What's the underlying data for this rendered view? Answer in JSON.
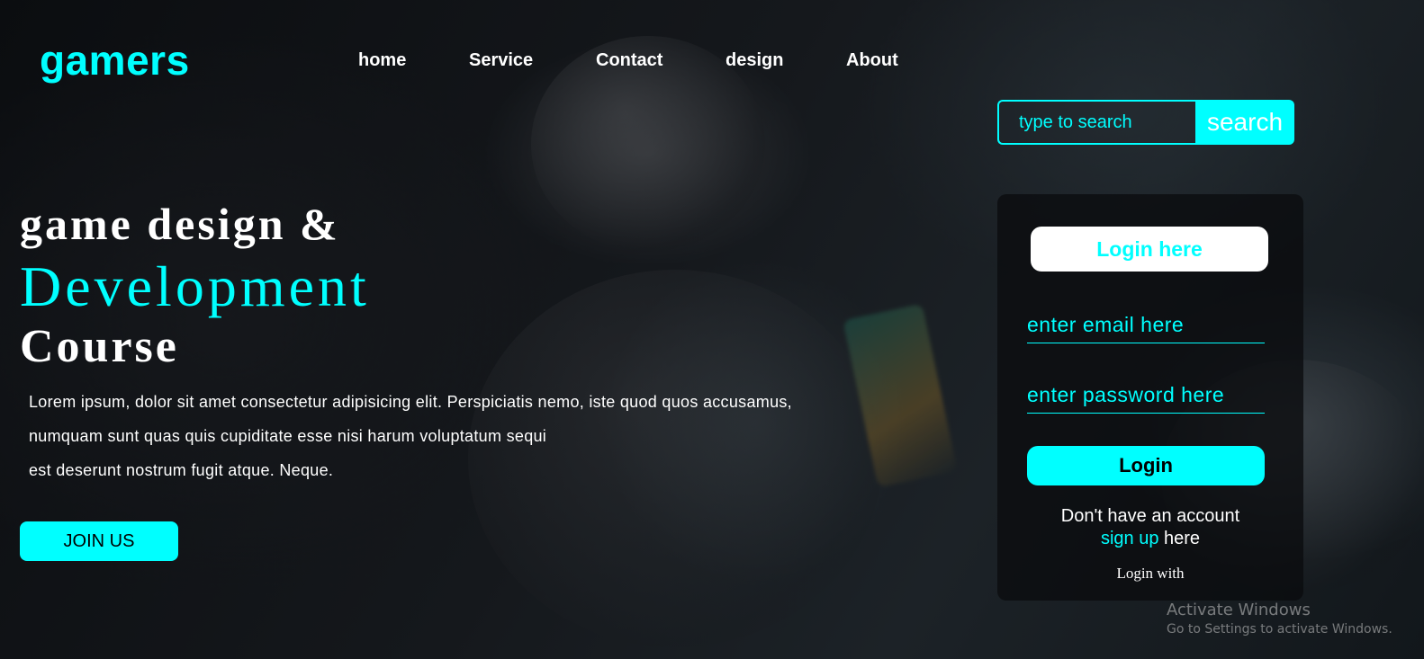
{
  "brand": {
    "logo": "gamers",
    "accent_color": "#00ffff"
  },
  "nav": {
    "items": [
      {
        "label": "home"
      },
      {
        "label": "Service"
      },
      {
        "label": "Contact"
      },
      {
        "label": "design"
      },
      {
        "label": "About"
      }
    ]
  },
  "search": {
    "placeholder": "type to search",
    "button_label": "search"
  },
  "hero": {
    "line1": "game design &",
    "line2": "Development",
    "line3": "Course",
    "paragraph": [
      "Lorem ipsum, dolor sit amet consectetur adipisicing elit. Perspiciatis nemo, iste quod quos accusamus,",
      "numquam sunt quas quis cupiditate esse nisi harum voluptatum sequi",
      "est deserunt nostrum fugit atque. Neque."
    ],
    "cta_label": "JOIN US"
  },
  "login": {
    "heading": "Login here",
    "email_placeholder": "enter email here",
    "password_placeholder": "enter password here",
    "submit_label": "Login",
    "no_account_text": "Don't have an account",
    "signup_link": "sign up",
    "signup_suffix": "here",
    "login_with": "Login with"
  },
  "watermark": {
    "title": "Activate Windows",
    "subtitle": "Go to Settings to activate Windows."
  }
}
